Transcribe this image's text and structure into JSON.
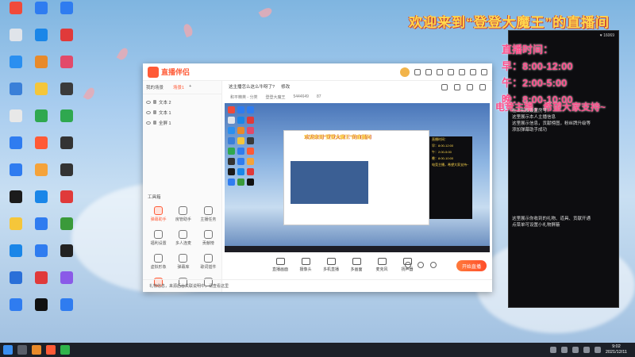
{
  "desktop": {
    "icons": [
      {
        "label": "",
        "color": "#f04a3a"
      },
      {
        "label": "",
        "color": "#2f7cf0"
      },
      {
        "label": "",
        "color": "#2f7cf0"
      },
      {
        "label": "",
        "color": "#e0e4ea"
      },
      {
        "label": "",
        "color": "#1a86e8"
      },
      {
        "label": "",
        "color": "#e03a3a"
      },
      {
        "label": "",
        "color": "#2a8ff0"
      },
      {
        "label": "",
        "color": "#e88a2a"
      },
      {
        "label": "",
        "color": "#e24a6a"
      },
      {
        "label": "",
        "color": "#3a7fd8"
      },
      {
        "label": "",
        "color": "#f5c63a"
      },
      {
        "label": "",
        "color": "#3a3a3a"
      },
      {
        "label": "",
        "color": "#e8e8e8"
      },
      {
        "label": "",
        "color": "#2fa84f"
      },
      {
        "label": "",
        "color": "#2fa84f"
      },
      {
        "label": "",
        "color": "#2f7cf0"
      },
      {
        "label": "",
        "color": "#ff5a36"
      },
      {
        "label": "",
        "color": "#333333"
      },
      {
        "label": "",
        "color": "#2f7cf0"
      },
      {
        "label": "",
        "color": "#f5a33a"
      },
      {
        "label": "",
        "color": "#333333"
      },
      {
        "label": "",
        "color": "#1b1b1b"
      },
      {
        "label": "",
        "color": "#1a86e8"
      },
      {
        "label": "",
        "color": "#e03a3a"
      },
      {
        "label": "",
        "color": "#f5c63a"
      },
      {
        "label": "",
        "color": "#2f7cf0"
      },
      {
        "label": "",
        "color": "#3a9a3a"
      },
      {
        "label": "",
        "color": "#1a86e8"
      },
      {
        "label": "",
        "color": "#2f7cf0"
      },
      {
        "label": "",
        "color": "#222222"
      },
      {
        "label": "",
        "color": "#2a6fd8"
      },
      {
        "label": "",
        "color": "#e03a3a"
      },
      {
        "label": "",
        "color": "#8a5ae8"
      },
      {
        "label": "",
        "color": "#2f7cf0"
      },
      {
        "label": "",
        "color": "#111111"
      },
      {
        "label": "",
        "color": "#2f7cf0"
      }
    ]
  },
  "banner": {
    "text": "欢迎来到“登登大魔王”的直播间"
  },
  "side_panel": {
    "stats": {
      "viewers": "",
      "fans": "",
      "likes": "♥ 16069"
    },
    "info_lines": [
      "",
      "",
      "",
      ""
    ],
    "schedule": {
      "title": "直播时间：",
      "morning": "早：8:00-12:00",
      "noon": "午：2:00-5:00",
      "night": "晚：8:00-10:00"
    },
    "promo": "电竞主播，希望大家支持~",
    "notice": "在上有权设置房号\n这里展示本人主播信息\n这里展示信息，贡献榜图，粉丝牌升级等\n添加弹幕助手成功",
    "gift_tip": "这里展示你收到的礼物、道具、贡献开通\n点菜单可设置小礼物屏蔽"
  },
  "app": {
    "logo": "直播伴侣",
    "scene_tabs": [
      "我的场景",
      "",
      "场景1"
    ],
    "sources": [
      "文本 2",
      "文本 1",
      "全屏 1"
    ],
    "room": {
      "title": "这主播怎么这么牛呀了?",
      "edit": "修改"
    },
    "meta": {
      "category": "和平精英 - 分类",
      "host": "登登大魔王",
      "room_id": "5444649",
      "fans": "87"
    },
    "tools_header": "工具箱",
    "tools": [
      {
        "label": "弹幕助手"
      },
      {
        "label": "房管助手"
      },
      {
        "label": "主播任务"
      },
      {
        "label": "福利设置"
      },
      {
        "label": "多人连麦"
      },
      {
        "label": "贡献榜"
      },
      {
        "label": "虚拟形象"
      },
      {
        "label": "弹幕库"
      },
      {
        "label": "歌词插件"
      },
      {
        "label": ""
      },
      {
        "label": ""
      },
      {
        "label": ""
      }
    ],
    "controls": [
      "直播画面",
      "摄像头",
      "多机直播",
      "多画面",
      "麦克风",
      "扬声器"
    ],
    "live_button": "开始直播",
    "status": {
      "warn": "礼物信息，来源后台关联说明中，请查看这里",
      "bitrate": "",
      "cpu": "",
      "fps": "",
      "time": ""
    }
  },
  "preview": {
    "nested_title": "欢迎来到“登登大魔王”的直播间",
    "nested_lines": [
      "直播时间：",
      "早：8:00-12:00",
      "午：2:00-5:00",
      "晚：8:00-10:00",
      "电竞主播，希望大家支持~"
    ]
  },
  "taskbar": {
    "time": "9:02",
    "date": "2021/12/11"
  }
}
